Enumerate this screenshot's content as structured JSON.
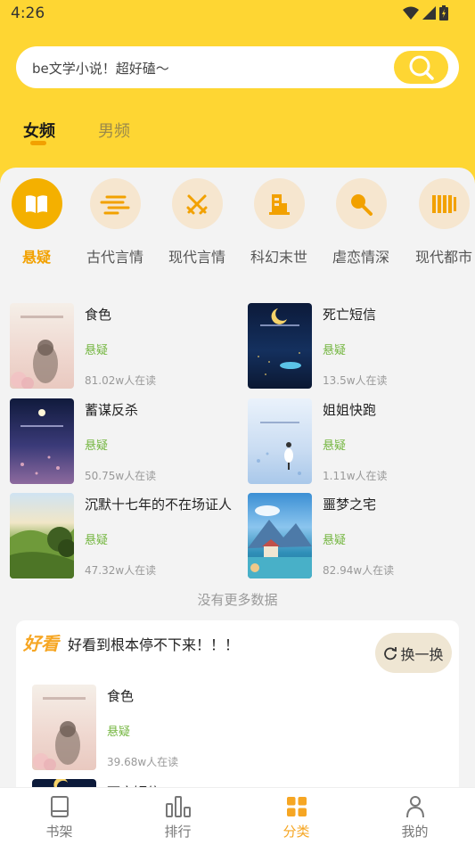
{
  "status": {
    "time": "4:26"
  },
  "search": {
    "text": "be文学小说！超好磕～"
  },
  "gender_tabs": [
    "女频",
    "男频"
  ],
  "categories": [
    "悬疑",
    "古代言情",
    "现代言情",
    "科幻末世",
    "虐恋情深",
    "现代都市"
  ],
  "books": [
    {
      "title": "食色",
      "genre": "悬疑",
      "readers": "81.02w人在读"
    },
    {
      "title": "死亡短信",
      "genre": "悬疑",
      "readers": "13.5w人在读"
    },
    {
      "title": "蓄谋反杀",
      "genre": "悬疑",
      "readers": "50.75w人在读"
    },
    {
      "title": "姐姐快跑",
      "genre": "悬疑",
      "readers": "1.11w人在读"
    },
    {
      "title": "沉默十七年的不在场证人",
      "genre": "悬疑",
      "readers": "47.32w人在读"
    },
    {
      "title": "噩梦之宅",
      "genre": "悬疑",
      "readers": "82.94w人在读"
    }
  ],
  "no_more": "没有更多数据",
  "recommend": {
    "logo": "好看",
    "slogan": "好看到根本停不下来！！！",
    "swap": "换一换",
    "book": {
      "title": "食色",
      "genre": "悬疑",
      "readers": "39.68w人在读"
    },
    "next_title": "死亡短信"
  },
  "nav": [
    "书架",
    "排行",
    "分类",
    "我的"
  ],
  "colors": {
    "accent": "#fed633",
    "active": "#f6a623",
    "genre": "#74b640"
  }
}
